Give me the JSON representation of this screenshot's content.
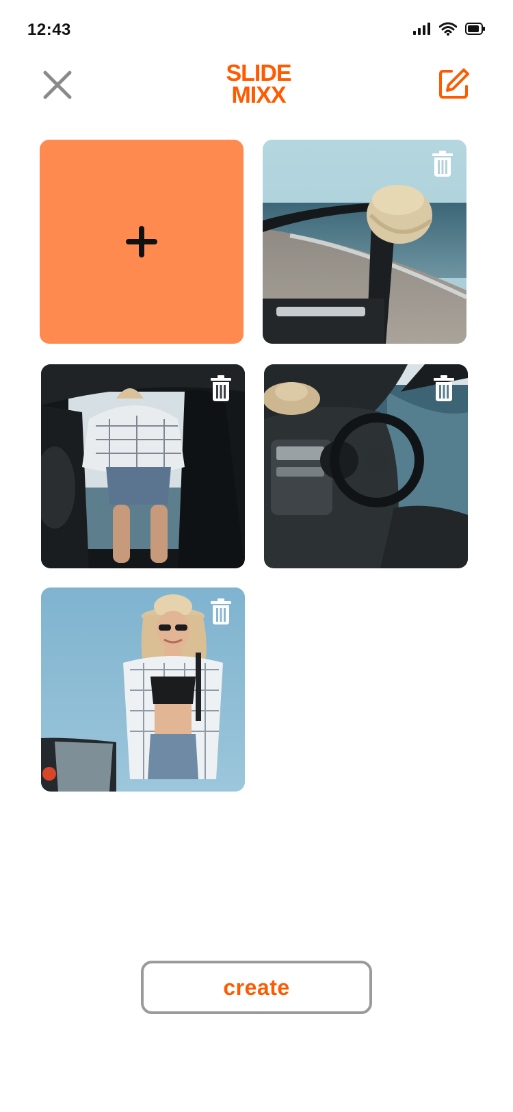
{
  "status_bar": {
    "time": "12:43"
  },
  "header": {
    "logo_line1": "SLIDE",
    "logo_line2": "MIXX"
  },
  "grid": {
    "add_tile_icon": "plus-icon",
    "photos": [
      {
        "name": "photo-hat-car-door-beach",
        "trash_icon": "trash-icon"
      },
      {
        "name": "photo-woman-plaid-shirt-car",
        "trash_icon": "trash-icon"
      },
      {
        "name": "photo-car-interior-steering-wheel-sea",
        "trash_icon": "trash-icon"
      },
      {
        "name": "photo-woman-hat-sunglasses",
        "trash_icon": "trash-icon"
      }
    ]
  },
  "actions": {
    "create_label": "create"
  },
  "colors": {
    "accent": "#FF5A00",
    "add_tile": "#FF8A50",
    "icon_gray": "#8a8a8a"
  }
}
